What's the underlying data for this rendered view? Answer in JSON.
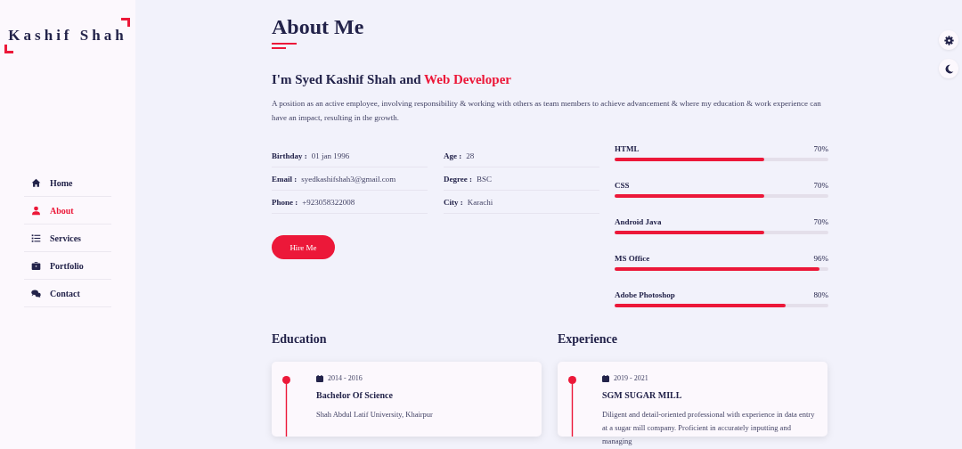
{
  "logo": "Kashif Shah",
  "nav": [
    {
      "label": "Home",
      "selected": false
    },
    {
      "label": "About",
      "selected": true
    },
    {
      "label": "Services",
      "selected": false
    },
    {
      "label": "Portfolio",
      "selected": false
    },
    {
      "label": "Contact",
      "selected": false
    }
  ],
  "title": "About Me",
  "intro": {
    "heading": "I'm Syed Kashif Shah and ",
    "highlight": "Web Developer",
    "text": "A position as an active employee, involving responsibility & working with others as team members to achieve advancement & where my education & work experience can have an impact, resulting in the growth."
  },
  "info_columns": [
    [
      {
        "label": "Birthday :",
        "value": "01 jan 1996"
      },
      {
        "label": "Email :",
        "value": "syedkashifshah3@gmail.com"
      },
      {
        "label": "Phone :",
        "value": "+923058322008"
      }
    ],
    [
      {
        "label": "Age :",
        "value": "28"
      },
      {
        "label": "Degree :",
        "value": "BSC"
      },
      {
        "label": "City :",
        "value": "Karachi"
      }
    ]
  ],
  "hire_button": "Hire Me",
  "skills": [
    {
      "name": "HTML",
      "reading": "70%",
      "level": 0.7
    },
    {
      "name": "CSS",
      "reading": "70%",
      "level": 0.7
    },
    {
      "name": "Android Java",
      "reading": "70%",
      "level": 0.7
    },
    {
      "name": "MS Office",
      "reading": "96%",
      "level": 0.96
    },
    {
      "name": "Adobe Photoshop",
      "reading": "80%",
      "level": 0.8
    }
  ],
  "timelines": [
    {
      "heading": "Education",
      "date": "2014 - 2016",
      "title": "Bachelor Of Science",
      "text": "Shah Abdul Latif University, Khairpur"
    },
    {
      "heading": "Experience",
      "date": "2019 - 2021",
      "title": "SGM SUGAR MILL",
      "text": "Diligent and detail-oriented professional with experience in data entry at a sugar mill company. Proficient in accurately inputting and managing"
    }
  ]
}
